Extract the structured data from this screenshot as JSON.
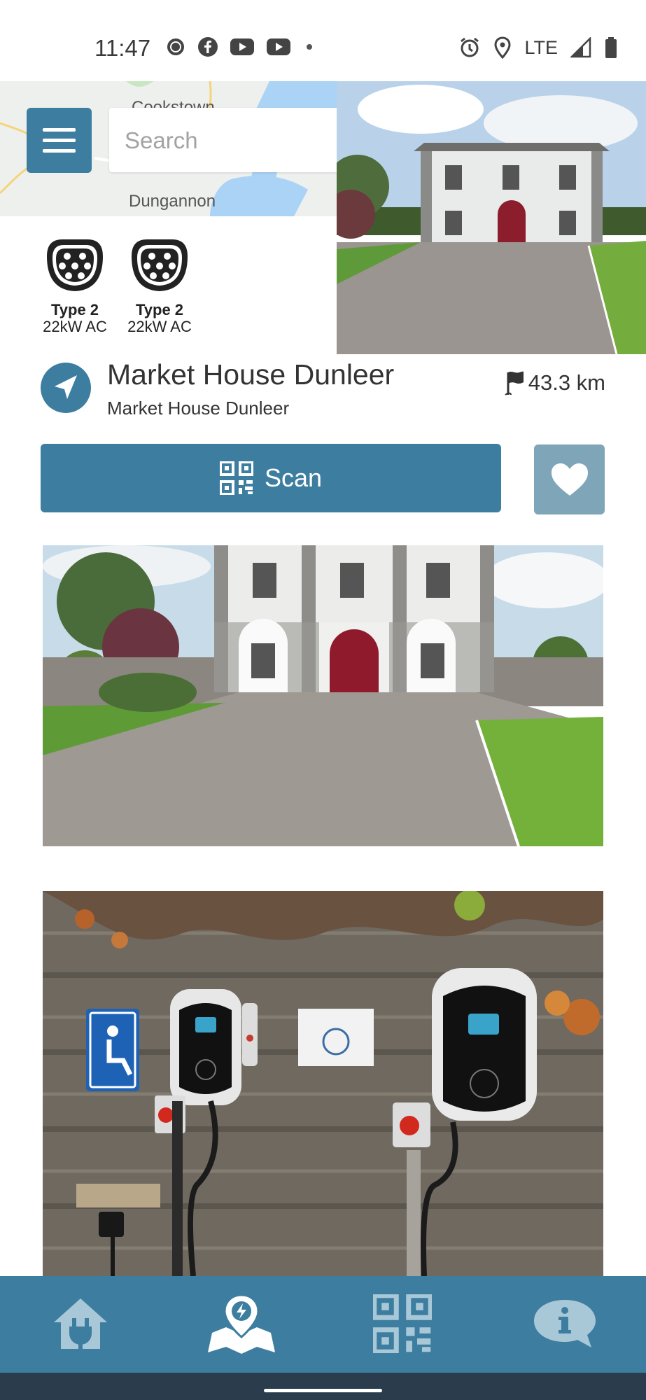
{
  "status_bar": {
    "time": "11:47",
    "left_icons": [
      "signal-app-icon",
      "facebook-icon",
      "youtube-icon",
      "youtube-icon",
      "dot-icon"
    ],
    "network": "LTE",
    "right_icons": [
      "alarm-icon",
      "location-icon",
      "signal-icon",
      "battery-icon"
    ]
  },
  "map": {
    "towns": [
      "Cookstown",
      "Dungannon"
    ]
  },
  "search": {
    "placeholder": "Search"
  },
  "connectors": [
    {
      "type": "Type 2",
      "power": "22kW AC"
    },
    {
      "type": "Type 2",
      "power": "22kW AC"
    }
  ],
  "station": {
    "name": "Market House Dunleer",
    "subtitle": "Market House Dunleer",
    "distance": "43.3 km"
  },
  "actions": {
    "scan_label": "Scan"
  },
  "bottom_nav": {
    "items": [
      "home-plug-icon",
      "map-pin-icon",
      "qr-code-icon",
      "info-icon"
    ],
    "active": "map-pin-icon"
  },
  "colors": {
    "primary": "#3d7ea0",
    "favorite_bg": "#7fa6b8",
    "system_bar": "#2b3d4c"
  }
}
